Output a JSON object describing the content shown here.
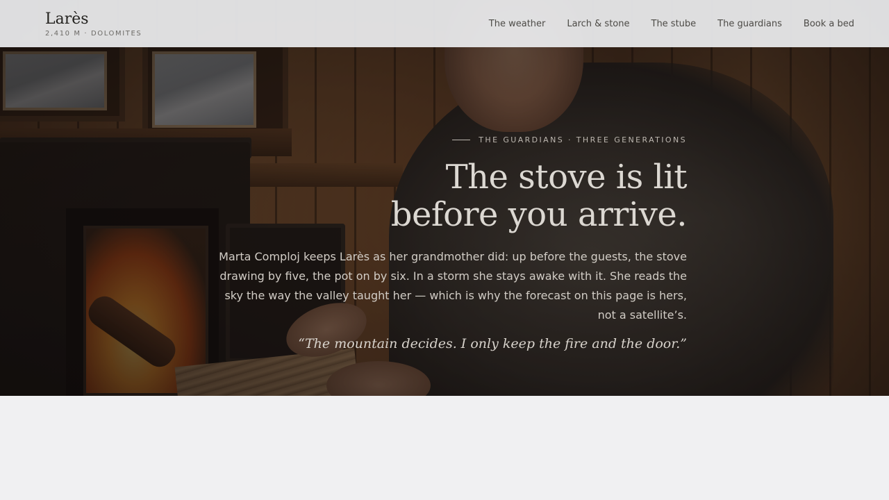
{
  "brand": {
    "name": "Larès",
    "tagline": "2,410 M · DOLOMITES"
  },
  "nav": {
    "items": [
      {
        "label": "The weather"
      },
      {
        "label": "Larch & stone"
      },
      {
        "label": "The stube"
      },
      {
        "label": "The guardians"
      },
      {
        "label": "Book a bed"
      }
    ]
  },
  "hero": {
    "kicker": "THE GUARDIANS · THREE GENERATIONS",
    "headline_line1": "The stove is lit",
    "headline_line2": "before you arrive.",
    "lede": "Marta Comploj keeps Larès as her grandmother did: up before the guests, the stove drawing by five, the pot on by six. In a storm she stays awake with it. She reads the sky the way the valley taught her — which is why the forecast on this page is hers, not a satellite’s.",
    "quote": "“The mountain decides. I only keep the fire and the door.”"
  },
  "colors": {
    "nav_bg": "#ecedef",
    "page_bg": "#f0f0f2",
    "hero_text": "#dcd8d2"
  }
}
